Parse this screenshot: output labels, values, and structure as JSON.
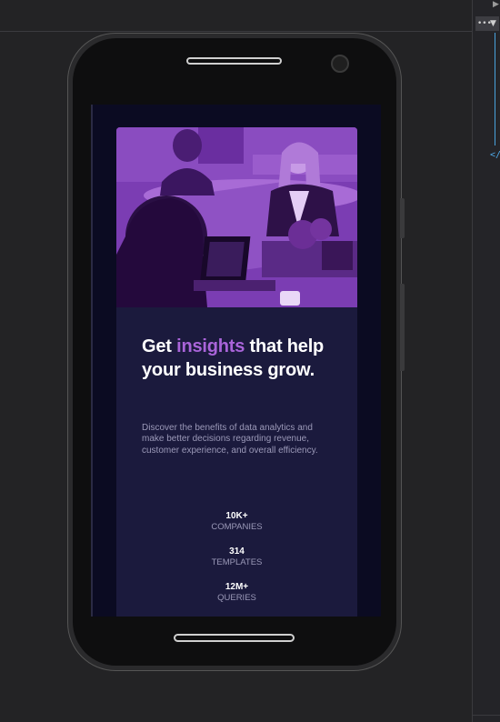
{
  "devtools": {
    "menu_glyph": "•••",
    "dropdown_glyph": "▼",
    "play_glyph": "▶",
    "closing_tag": "</"
  },
  "card": {
    "image_alt": "Women working with laptops in an office",
    "headline": {
      "part1": "Get ",
      "accent": "insights",
      "part2": " that help your business grow."
    },
    "description": "Discover the benefits of data analytics and make better decisions regarding revenue, customer experience, and overall efficiency.",
    "stats": [
      {
        "value": "10K+",
        "label": "companies"
      },
      {
        "value": "314",
        "label": "templates"
      },
      {
        "value": "12M+",
        "label": "queries"
      }
    ]
  },
  "colors": {
    "page_bg": "#0b0b22",
    "card_bg": "#1b1a3d",
    "accent": "#a964d9",
    "photo_overlay": "#7c3fb5",
    "text_muted": "#9b99b8"
  }
}
